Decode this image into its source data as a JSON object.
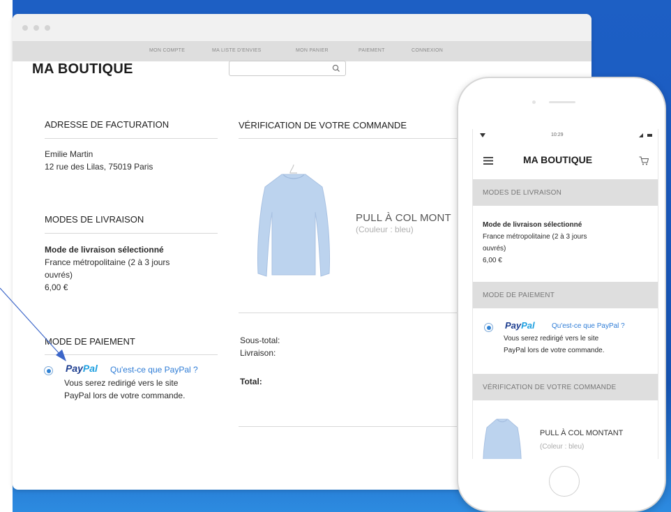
{
  "desktop": {
    "nav": [
      "MON COMPTE",
      "MA LISTE D'ENVIES",
      "MON PANIER",
      "PAIEMENT",
      "CONNEXION"
    ],
    "shop_title": "MA BOUTIQUE",
    "search_placeholder": "",
    "billing": {
      "heading": "ADRESSE DE FACTURATION",
      "name": "Emilie Martin",
      "address": "12 rue des Lilas, 75019 Paris"
    },
    "delivery": {
      "heading": "MODES DE LIVRAISON",
      "selected_label": "Mode de livraison sélectionné",
      "line1": "France métropolitaine (2 à 3 jours",
      "line2": "ouvrés)",
      "price": "6,00 €"
    },
    "payment": {
      "heading": "MODE DE PAIEMENT",
      "paypal_part1": "Pay",
      "paypal_part2": "Pal",
      "paypal_link": "Qu'est-ce que PayPal ?",
      "note_line1": "Vous serez redirigé vers le site",
      "note_line2": "PayPal lors de votre commande."
    },
    "review": {
      "heading": "VÉRIFICATION DE VOTRE COMMANDE",
      "product_name": "PULL À COL MONT",
      "product_color": "(Couleur : bleu)",
      "subtotal_label": "Sous-total:",
      "shipping_label": "Livraison:",
      "total_label": "Total:"
    }
  },
  "mobile": {
    "time": "10:29",
    "shop_title": "MA BOUTIQUE",
    "delivery_band": "MODES DE LIVRAISON",
    "delivery_selected": "Mode de livraison sélectionné",
    "delivery_line1": "France métropolitaine (2 à 3 jours",
    "delivery_line2": "ouvrés)",
    "delivery_price": "6,00 €",
    "payment_band": "MODE DE PAIEMENT",
    "paypal_part1": "Pay",
    "paypal_part2": "Pal",
    "paypal_link": "Qu'est-ce que PayPal ?",
    "note_line1": "Vous serez redirigé vers le site",
    "note_line2": "PayPal lors de votre commande.",
    "review_band": "VÉRIFICATION DE VOTRE COMMANDE",
    "product_name": "PULL À COL MONTANT",
    "product_color": "(Coleur : bleu)"
  },
  "colors": {
    "background": "#1a5ac0",
    "paypal_dark": "#1d3d8f",
    "paypal_light": "#1fa0e0",
    "link": "#2e7cd6",
    "sweater": "#bcd3ee"
  }
}
